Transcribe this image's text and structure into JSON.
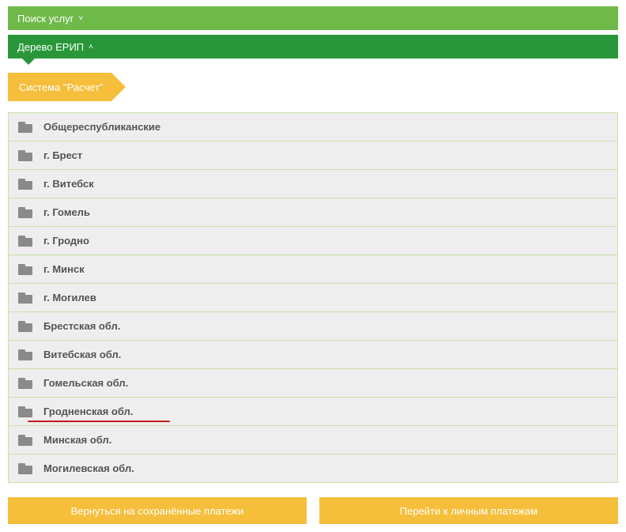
{
  "bars": {
    "search_label": "Поиск услуг",
    "tree_label": "Дерево ЕРИП"
  },
  "breadcrumb": {
    "current": "Система \"Расчет\""
  },
  "categories": [
    {
      "label": "Общереспубликанские",
      "underline": false
    },
    {
      "label": "г. Брест",
      "underline": false
    },
    {
      "label": "г. Витебск",
      "underline": false
    },
    {
      "label": "г. Гомель",
      "underline": false
    },
    {
      "label": "г. Гродно",
      "underline": false
    },
    {
      "label": "г. Минск",
      "underline": false
    },
    {
      "label": "г. Могилев",
      "underline": false
    },
    {
      "label": "Брестская обл.",
      "underline": false
    },
    {
      "label": "Витебская обл.",
      "underline": false
    },
    {
      "label": "Гомельская обл.",
      "underline": false
    },
    {
      "label": "Гродненская обл.",
      "underline": true
    },
    {
      "label": "Минская обл.",
      "underline": false
    },
    {
      "label": "Могилевская обл.",
      "underline": false
    }
  ],
  "buttons": {
    "back_label": "Вернуться на сохранённые платежи",
    "personal_label": "Перейти к личным платежам"
  }
}
